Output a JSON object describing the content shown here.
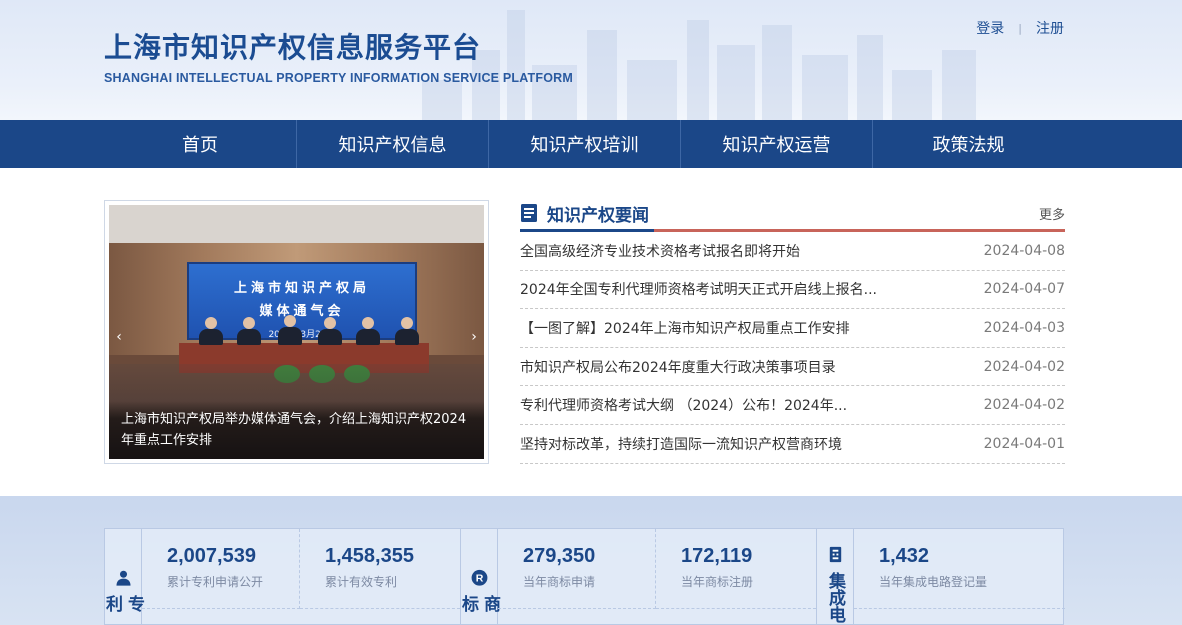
{
  "header": {
    "title": "上海市知识产权信息服务平台",
    "subtitle": "SHANGHAI INTELLECTUAL PROPERTY INFORMATION SERVICE PLATFORM",
    "login": "登录",
    "separator": "|",
    "register": "注册"
  },
  "nav": {
    "items": [
      "首页",
      "知识产权信息",
      "知识产权培训",
      "知识产权运营",
      "政策法规"
    ]
  },
  "carousel": {
    "screen_line1": "上海市知识产权局",
    "screen_line2": "媒体通气会",
    "screen_line3": "2024年3月26日",
    "caption": "上海市知识产权局举办媒体通气会，介绍上海知识产权2024年重点工作安排",
    "prev": "‹",
    "next": "›"
  },
  "news": {
    "title": "知识产权要闻",
    "more": "更多",
    "items": [
      {
        "title": "全国高级经济专业技术资格考试报名即将开始",
        "date": "2024-04-08"
      },
      {
        "title": "2024年全国专利代理师资格考试明天正式开启线上报名...",
        "date": "2024-04-07"
      },
      {
        "title": "【一图了解】2024年上海市知识产权局重点工作安排",
        "date": "2024-04-03"
      },
      {
        "title": "市知识产权局公布2024年度重大行政决策事项目录",
        "date": "2024-04-02"
      },
      {
        "title": "专利代理师资格考试大纲 （2024）公布！2024年...",
        "date": "2024-04-02"
      },
      {
        "title": "坚持对标改革，持续打造国际一流知识产权营商环境",
        "date": "2024-04-01"
      }
    ]
  },
  "stats": {
    "groups": [
      {
        "label": "专利",
        "icon": "person-icon"
      },
      {
        "label": "商标",
        "icon": "registered-icon"
      },
      {
        "label": "集成电",
        "icon": "circuit-icon"
      }
    ],
    "items": [
      {
        "value": "2,007,539",
        "label": "累计专利申请公开"
      },
      {
        "value": "1,458,355",
        "label": "累计有效专利"
      },
      {
        "value": "279,350",
        "label": "当年商标申请"
      },
      {
        "value": "172,119",
        "label": "当年商标注册"
      },
      {
        "value": "1,432",
        "label": "当年集成电路登记量"
      }
    ]
  },
  "colors": {
    "primary": "#1b4788",
    "accent": "#c8645a"
  }
}
